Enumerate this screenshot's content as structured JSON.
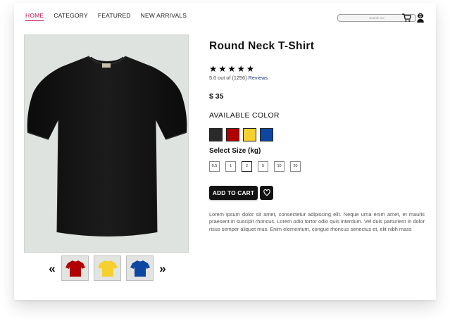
{
  "nav": {
    "items": [
      {
        "label": "HOME",
        "active": true
      },
      {
        "label": "CATEGORY",
        "active": false
      },
      {
        "label": "FEATURED",
        "active": false
      },
      {
        "label": "NEW ARRIVALS",
        "active": false
      }
    ],
    "active_color": "#c2185b"
  },
  "search": {
    "placeholder": "Search me"
  },
  "header_icons": [
    "cart-icon",
    "user-icon"
  ],
  "product": {
    "title": "Round Neck T-Shirt",
    "stars": [
      "★",
      "★",
      "★",
      "★",
      "★"
    ],
    "rating_text": "5.0 out of (1256) ",
    "reviews_label": "Reviews",
    "price": "$ 35",
    "color_title": "AVAILABLE COLOR",
    "colors": [
      "#2a2a2a",
      "#b00000",
      "#f5d02f",
      "#0d47a1"
    ],
    "size_title": "Select Size (kg)",
    "sizes": [
      "0.5",
      "1",
      "2",
      "5",
      "10",
      "20"
    ],
    "selected_size": "2",
    "add_to_cart_label": "ADD TO CART",
    "description": "Lorem ipsum dolor sit amet, consectetur adipiscing elit. Neque urna enim amet, et mauris praesent in suscipit rhoncus. Lorem odio tortor odio quis interdum. Vel duis parturient in dolor risus semper aliquet mus. Enim elementum, congue rhoncus senectus et, elit nibh mass",
    "main_image_color": "#111111",
    "thumbnail_colors": [
      "#b00000",
      "#f5d02f",
      "#0d47a1"
    ]
  },
  "carousel": {
    "prev": "«",
    "next": "»"
  }
}
